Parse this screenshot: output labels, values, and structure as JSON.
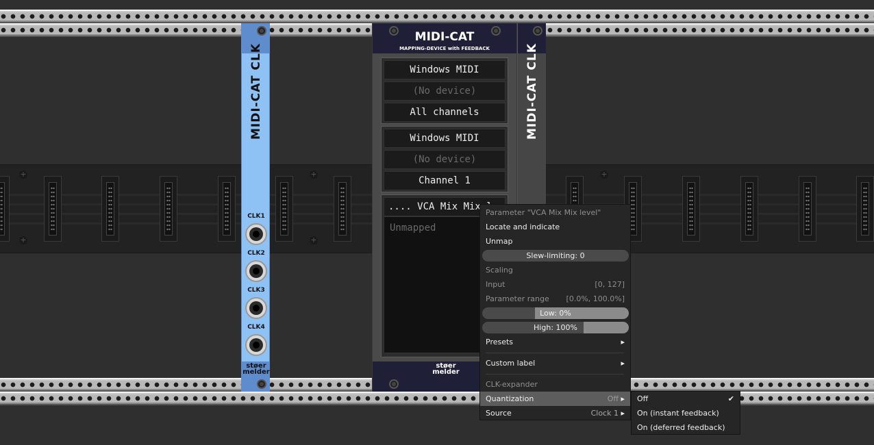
{
  "clk_module": {
    "title": "MIDI-CAT CLK",
    "jacks": [
      "CLK1",
      "CLK2",
      "CLK3",
      "CLK4"
    ],
    "brand_line1": "støer",
    "brand_line2": "melder"
  },
  "midicat": {
    "title": "MIDI-CAT",
    "subtitle": "MAPPING-DEVICE with FEEDBACK",
    "input": {
      "driver": "Windows MIDI",
      "device": "(No device)",
      "channel": "All channels"
    },
    "output": {
      "driver": "Windows MIDI",
      "device": "(No device)",
      "channel": "Channel 1"
    },
    "mapping": {
      "selected": ".... VCA Mix Mix leve",
      "empty_label": "Unmapped"
    },
    "brand_line1": "støer",
    "brand_line2": "melder"
  },
  "expander": {
    "title": "MIDI-CAT CLK"
  },
  "context_menu": {
    "header": "Parameter \"VCA Mix Mix level\"",
    "locate": "Locate and indicate",
    "unmap": "Unmap",
    "slew": {
      "label": "Slew-limiting: 0",
      "level": 0
    },
    "scaling_header": "Scaling",
    "input_label": "Input",
    "input_value": "[0, 127]",
    "param_range_label": "Parameter range",
    "param_range_value": "[0.0%, 100.0%]",
    "low": {
      "label": "Low: 0%",
      "level": 0
    },
    "high": {
      "label": "High: 100%",
      "level": 1.0
    },
    "presets": "Presets",
    "custom_label": "Custom label",
    "clk_header": "CLK-expander",
    "quantization_label": "Quantization",
    "quantization_value": "Off",
    "source_label": "Source",
    "source_value": "Clock 1",
    "arrow": "▸"
  },
  "quantization_submenu": {
    "options": [
      "Off",
      "On (instant feedback)",
      "On (deferred feedback)"
    ],
    "selected": "Off",
    "check": "✔"
  }
}
